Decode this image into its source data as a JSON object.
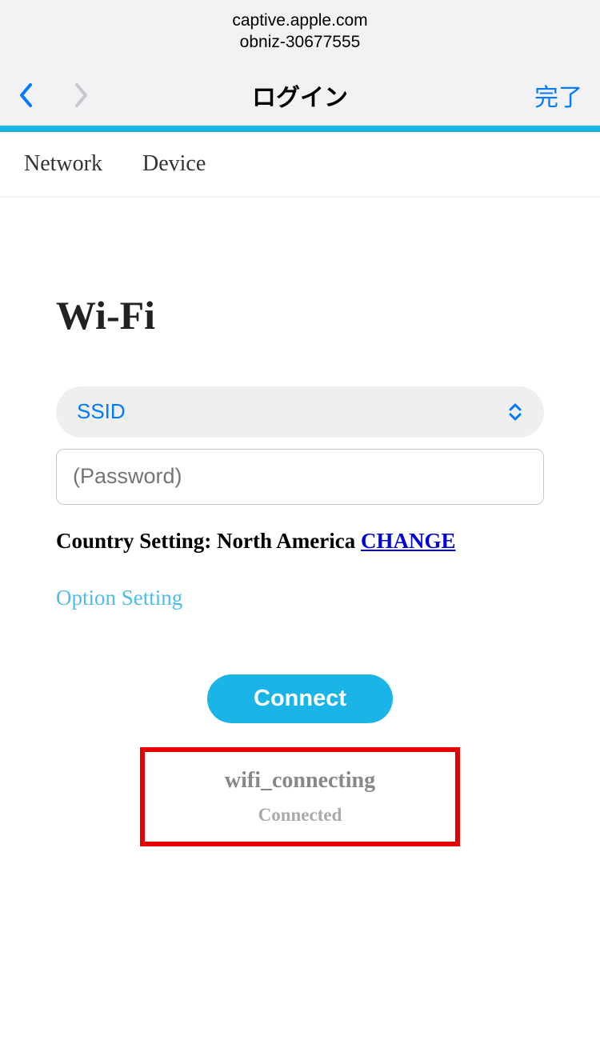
{
  "captive": {
    "url": "captive.apple.com",
    "ssid_name": "obniz-30677555"
  },
  "nav": {
    "title": "ログイン",
    "done": "完了"
  },
  "tabs": {
    "network": "Network",
    "device": "Device"
  },
  "wifi": {
    "title": "Wi-Fi",
    "ssid_label": "SSID",
    "password_placeholder": "(Password)",
    "country_label": "Country Setting: ",
    "country_value": "North America",
    "change_label": "CHANGE",
    "option_label": "Option Setting",
    "connect_label": "Connect",
    "status_primary": "wifi_connecting",
    "status_secondary": "Connected"
  }
}
